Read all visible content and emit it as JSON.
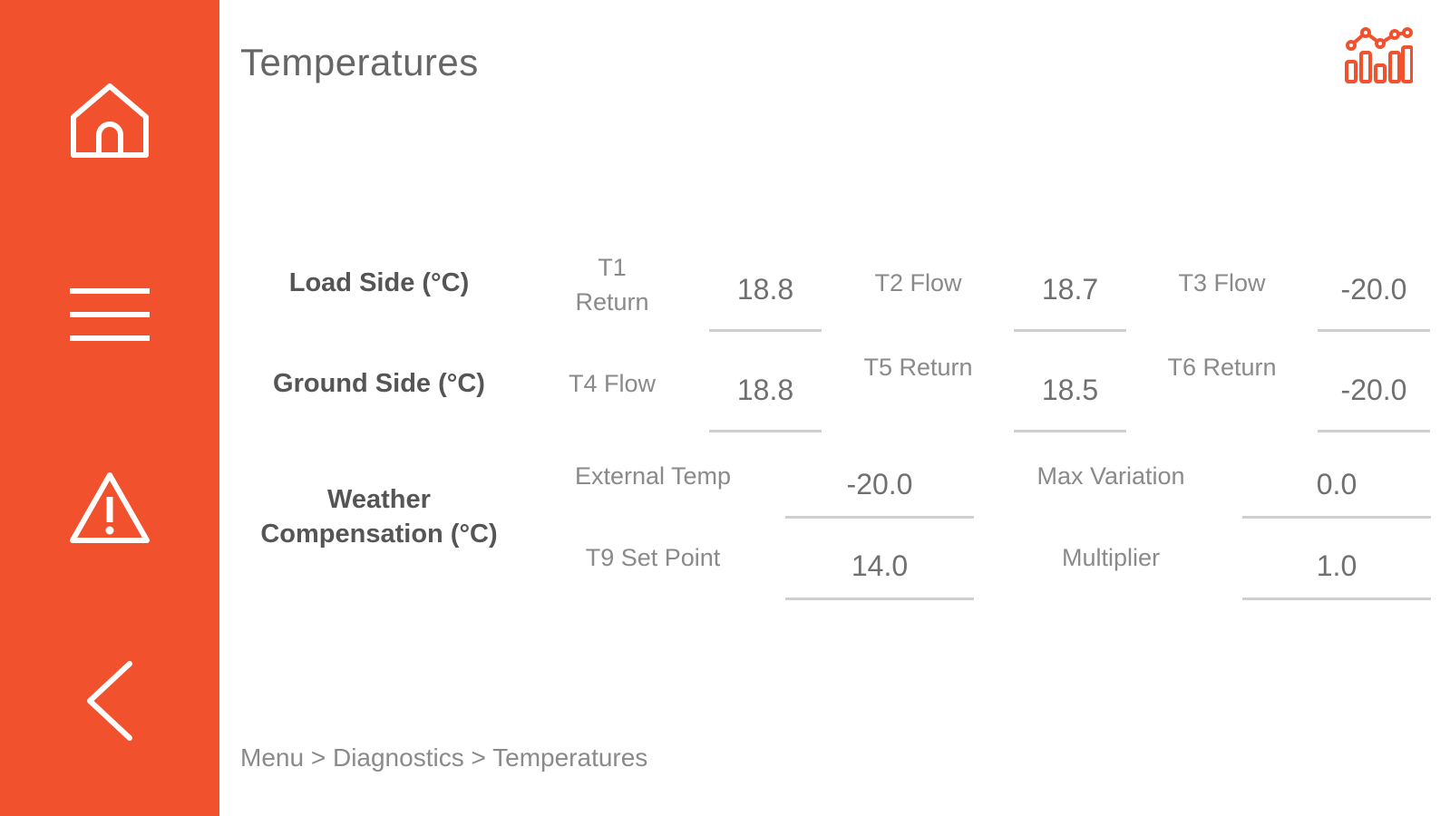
{
  "page": {
    "title": "Temperatures"
  },
  "sidebar": {
    "items": [
      {
        "name": "home",
        "icon": "home-icon"
      },
      {
        "name": "menu",
        "icon": "hamburger-menu-icon"
      },
      {
        "name": "alarms",
        "icon": "warning-icon"
      },
      {
        "name": "back",
        "icon": "chevron-left-icon"
      }
    ]
  },
  "header": {
    "chart_icon": "chart-icon"
  },
  "load_side": {
    "label": "Load Side (°C)",
    "fields": [
      {
        "label": "T1 Return",
        "value": "18.8"
      },
      {
        "label": "T2 Flow",
        "value": "18.7"
      },
      {
        "label": "T3 Flow",
        "value": "-20.0"
      }
    ]
  },
  "ground_side": {
    "label": "Ground Side (°C)",
    "fields": [
      {
        "label": "T4 Flow",
        "value": "18.8"
      },
      {
        "label": "T5 Return",
        "value": "18.5"
      },
      {
        "label": "T6 Return",
        "value": "-20.0"
      }
    ]
  },
  "weather_compensation": {
    "label": "Weather Compensation (°C)",
    "fields": [
      {
        "label": "External Temp",
        "value": "-20.0"
      },
      {
        "label": "Max Variation",
        "value": "0.0"
      },
      {
        "label": "T9 Set Point",
        "value": "14.0"
      },
      {
        "label": "Multiplier",
        "value": "1.0"
      }
    ]
  },
  "breadcrumb": {
    "items": [
      "Menu",
      "Diagnostics",
      "Temperatures"
    ],
    "separator": ">"
  },
  "colors": {
    "accent": "#f2512e",
    "underline": "#cfcfcf",
    "text": "#6e6e6e"
  }
}
